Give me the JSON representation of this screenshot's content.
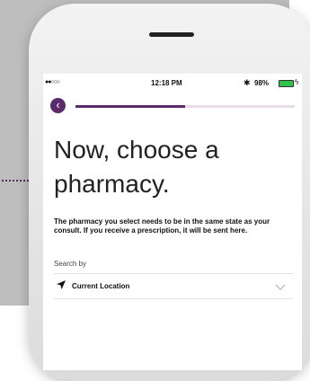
{
  "status_bar": {
    "signal": "●●○○○",
    "time": "12:18 PM",
    "bluetooth_icon": "bluetooth-icon",
    "battery": "98%",
    "battery_level": 0.98,
    "charging_icon": "charging-bolt-icon"
  },
  "nav": {
    "back_icon": "back-arrow-icon",
    "progress": 0.5
  },
  "headline": "Now, choose a pharmacy.",
  "description": "The pharmacy you select needs to be in the same state as your consult. If you receive a prescription, it will be sent here.",
  "search": {
    "label": "Search by",
    "selected": "Current Location",
    "location_icon": "location-arrow-icon",
    "chevron_icon": "chevron-down-icon"
  },
  "colors": {
    "accent": "#5a2a6b",
    "progress_track": "#eadbe8",
    "battery": "#2ec24a",
    "background_panel": "#bebebe"
  }
}
